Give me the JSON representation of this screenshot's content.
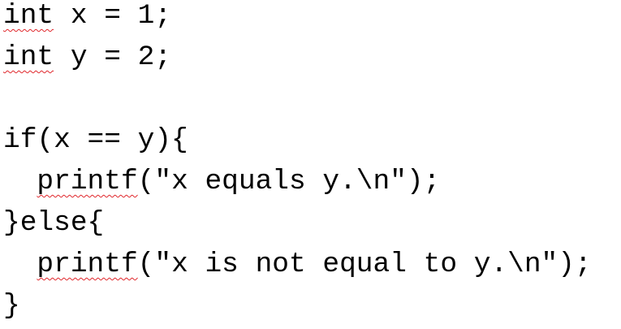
{
  "document": {
    "lines": [
      {
        "misspelled": "int",
        "rest": " x = 1;"
      },
      {
        "misspelled": "int",
        "rest": " y = 2;"
      },
      {
        "text": ""
      },
      {
        "text": "if(x == y){"
      },
      {
        "indent": "  ",
        "misspelled": "printf",
        "rest": "(\"x equals y.\\n\");"
      },
      {
        "text": "}else{"
      },
      {
        "indent": "  ",
        "misspelled": "printf",
        "rest": "(\"x is not equal to y.\\n\");"
      },
      {
        "text": "}"
      }
    ],
    "spellcheck_color": "#e0262b"
  }
}
